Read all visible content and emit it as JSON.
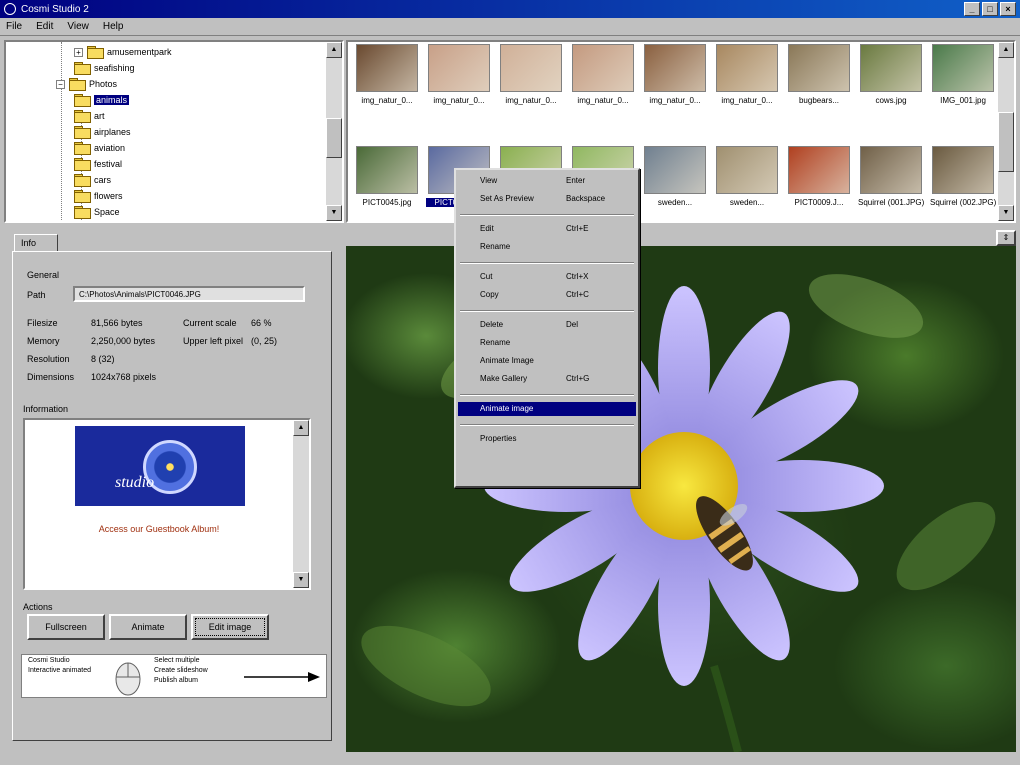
{
  "window": {
    "title": "Cosmi Studio 2",
    "minimize": "_",
    "maximize": "□",
    "close": "×"
  },
  "menu": [
    "File",
    "Edit",
    "View",
    "Help"
  ],
  "tree": [
    {
      "label": "amusementpark",
      "selected": false
    },
    {
      "label": "seafishing",
      "selected": false
    },
    {
      "label": "Photos",
      "selected": false
    },
    {
      "label": "animals",
      "selected": true
    },
    {
      "label": "art",
      "selected": false
    },
    {
      "label": "airplanes",
      "selected": false
    },
    {
      "label": "aviation",
      "selected": false
    },
    {
      "label": "festival",
      "selected": false
    },
    {
      "label": "cars",
      "selected": false
    },
    {
      "label": "flowers",
      "selected": false
    },
    {
      "label": "Space",
      "selected": false
    }
  ],
  "thumbnails": {
    "row1": [
      {
        "caption": "img_natur_0...",
        "color": "#6a4a30"
      },
      {
        "caption": "img_natur_0...",
        "color": "#c8a088"
      },
      {
        "caption": "img_natur_0...",
        "color": "#d0b098"
      },
      {
        "caption": "img_natur_0...",
        "color": "#c49a80"
      },
      {
        "caption": "img_natur_0...",
        "color": "#8a6040"
      },
      {
        "caption": "img_natur_0...",
        "color": "#a88860"
      },
      {
        "caption": "bugbears...",
        "color": "#8a7858"
      },
      {
        "caption": "cows.jpg",
        "color": "#6a7a40"
      },
      {
        "caption": "IMG_001.jpg",
        "color": "#4a7a4a"
      }
    ],
    "row2": [
      {
        "caption": "PICT0045.jpg",
        "color": "#4a6a38",
        "selected": false
      },
      {
        "caption": "PICT0046.jpg",
        "color": "#5a6aa0",
        "selected": true
      },
      {
        "caption": "",
        "color": "#8ab050",
        "selected": false
      },
      {
        "caption": "",
        "color": "#90b860",
        "selected": false
      },
      {
        "caption": "sweden...",
        "color": "#708090",
        "selected": false
      },
      {
        "caption": "sweden...",
        "color": "#a09070",
        "selected": false
      },
      {
        "caption": "PICT0009.J...",
        "color": "#b04020",
        "selected": false
      },
      {
        "caption": "Squirrel (001.JPG)",
        "color": "#706048",
        "selected": false
      },
      {
        "caption": "Squirrel (002.JPG)",
        "color": "#6a5a40",
        "selected": false
      }
    ]
  },
  "panel": {
    "tab_label": "Info",
    "general_label": "General",
    "path_label": "Path",
    "path_value": "C:\\Photos\\Animals\\PICT0046.JPG",
    "filesize_label": "Filesize",
    "filesize_value": "81,566 bytes",
    "memory_label": "Memory",
    "memory_value": "2,250,000 bytes",
    "resolution_label": "Resolution",
    "resolution_value": "8 (32)",
    "dimensions_label": "Dimensions",
    "dimensions_value": "1024x768 pixels",
    "zoom_label": "Current scale",
    "zoom_value": "66 %",
    "pixel_label": "Upper left pixel",
    "pixel_value": "(0, 25)",
    "information_label": "Information",
    "logo_text": "studio",
    "info_link": "Access our Guestbook Album!",
    "actions_label": "Actions",
    "btn_fullscreen": "Fullscreen",
    "btn_animate": "Animate",
    "btn_editimage": "Edit image",
    "banner_line1": "Cosmi Studio",
    "banner_line2": "Interactive animated",
    "banner_line3": "Select multiple",
    "banner_line4": "Create slideshow",
    "banner_line5": "Publish album"
  },
  "context_menu": [
    {
      "label": "View",
      "shortcut": "Enter"
    },
    {
      "label": "Set As Preview",
      "shortcut": "Backspace"
    },
    {
      "sep": true
    },
    {
      "label": "Edit",
      "shortcut": "Ctrl+E"
    },
    {
      "label": "Rename",
      "shortcut": ""
    },
    {
      "sep": true
    },
    {
      "label": "Cut",
      "shortcut": "Ctrl+X"
    },
    {
      "label": "Copy",
      "shortcut": "Ctrl+C"
    },
    {
      "sep": true
    },
    {
      "label": "Delete",
      "shortcut": "Del"
    },
    {
      "label": "Rename",
      "shortcut": ""
    },
    {
      "label": "Animate Image",
      "shortcut": ""
    },
    {
      "label": "Make Gallery",
      "shortcut": "Ctrl+G"
    },
    {
      "sep": true
    },
    {
      "label": "Animate image",
      "shortcut": "",
      "selected": true
    },
    {
      "sep": true
    },
    {
      "label": "Properties",
      "shortcut": ""
    }
  ],
  "colors": {
    "titlebar": "#000080",
    "selection": "#000080",
    "logo_bg": "#1a2a9c",
    "petal": "#b0a8f0",
    "center": "#f0d020"
  }
}
